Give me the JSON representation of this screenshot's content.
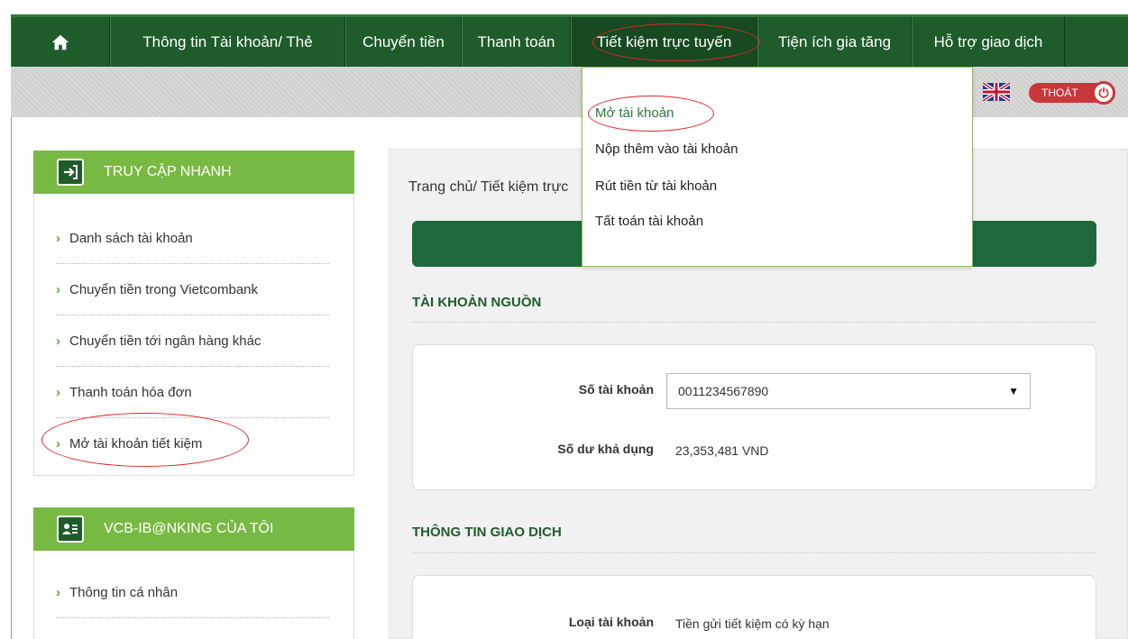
{
  "nav": {
    "home_icon": "home-icon",
    "items": [
      {
        "label": "Thông tin Tài khoản/ Thẻ"
      },
      {
        "label": "Chuyển tiền"
      },
      {
        "label": "Thanh toán"
      },
      {
        "label": "Tiết kiệm trực tuyến"
      },
      {
        "label": "Tiện ích gia tăng"
      },
      {
        "label": "Hỗ trợ giao dịch"
      }
    ]
  },
  "header": {
    "language_icon": "uk-flag-icon",
    "logout_label": "THOÁT",
    "logout_icon": "power-icon"
  },
  "dropdown": {
    "items": [
      {
        "label": "Mở tài khoản"
      },
      {
        "label": "Nộp thêm vào tài khoản"
      },
      {
        "label": "Rút tiền từ tài khoản"
      },
      {
        "label": "Tất toán tài khoản"
      }
    ]
  },
  "sidebar": {
    "quick_access": {
      "title": "TRUY CẬP NHANH",
      "icon": "sign-in-icon",
      "items": [
        {
          "label": "Danh sách tài khoản"
        },
        {
          "label": "Chuyển tiền trong Vietcombank"
        },
        {
          "label": "Chuyển tiền tới ngân hàng khác"
        },
        {
          "label": "Thanh toán hóa đơn"
        },
        {
          "label": "Mở tài khoản tiết kiệm"
        }
      ]
    },
    "my_ibanking": {
      "title": "VCB-IB@NKING CỦA TÔI",
      "icon": "user-card-icon",
      "items": [
        {
          "label": "Thông tin cá nhân"
        }
      ]
    }
  },
  "main": {
    "breadcrumb": "Trang chủ/ Tiết kiệm trực",
    "source_section": {
      "title": "TÀI KHOẢN NGUỒN",
      "account_label": "Số tài khoản",
      "account_value": "0011234567890",
      "balance_label": "Số dư khả dụng",
      "balance_value": "23,353,481 VND"
    },
    "transaction_section": {
      "title": "THÔNG TIN GIAO DỊCH",
      "account_type_label": "Loại tài khoản",
      "account_type_value": "Tiền gửi tiết kiệm có kỳ hạn"
    }
  },
  "colors": {
    "nav_green": "#1e5c2a",
    "side_green": "#78b943",
    "accent_red": "#e0262b"
  }
}
